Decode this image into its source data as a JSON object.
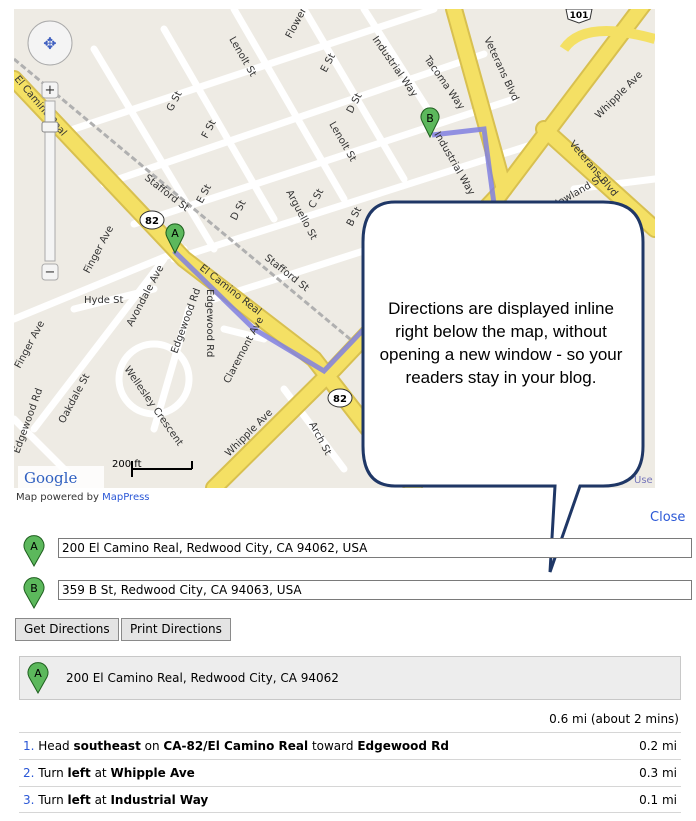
{
  "map": {
    "streets": [
      "Veterans Blvd",
      "Whipple Ave",
      "Veterans Blvd",
      "El Camino Real",
      "El Camino Real",
      "Stafford St",
      "Stafford St",
      "Industrial Way",
      "Industrial Way",
      "Tacoma Way",
      "Lenolt St",
      "Lenolt St",
      "E St",
      "D St",
      "F St",
      "G St",
      "E St",
      "D St",
      "C St",
      "B St",
      "Arguello St",
      "Flower St",
      "Finger Ave",
      "Finger Ave",
      "Hyde St",
      "Avondale Ave",
      "Edgewood Rd",
      "Edgewood Rd",
      "Edgewood Rd",
      "Claremont Ave",
      "Wellesley Crescent",
      "Oakdale St",
      "Whipple Ave",
      "Arch St",
      "Howland St"
    ],
    "highway_shields": [
      "101",
      "82",
      "82"
    ],
    "marker_a_label": "A",
    "marker_b_label": "B",
    "google_logo": "Google",
    "scale_label": "200 ft",
    "terms_label": "Use",
    "route_color": "#8080e0"
  },
  "powered_by": {
    "prefix": "Map powered by ",
    "link": "MapPress"
  },
  "callout": {
    "text": "Directions are displayed inline right below the map, without opening a new window - so your readers stay in your blog."
  },
  "directions_form": {
    "close_label": "Close",
    "from_label": "A",
    "from_value": "200 El Camino Real, Redwood City, CA 94062, USA",
    "to_label": "B",
    "to_value": "359 B St, Redwood City, CA 94063, USA",
    "get_directions_label": "Get Directions",
    "print_directions_label": "Print Directions"
  },
  "results": {
    "start_label": "A",
    "start_address": "200 El Camino Real, Redwood City, CA 94062",
    "summary": "0.6 mi (about 2 mins)",
    "steps": [
      {
        "num": "1.",
        "pre": "Head ",
        "b1": "southeast",
        "mid1": " on ",
        "b2": "CA-82/El Camino Real",
        "mid2": " toward ",
        "b3": "Edgewood Rd",
        "distance": "0.2 mi"
      },
      {
        "num": "2.",
        "pre": "Turn ",
        "b1": "left",
        "mid1": " at ",
        "b2": "Whipple Ave",
        "mid2": "",
        "b3": "",
        "distance": "0.3 mi"
      },
      {
        "num": "3.",
        "pre": "Turn ",
        "b1": "left",
        "mid1": " at ",
        "b2": "Industrial Way",
        "mid2": "",
        "b3": "",
        "distance": "0.1 mi"
      }
    ]
  },
  "colors": {
    "major_road": "#f4e064",
    "road_edge": "#d8c050",
    "link": "#2a57d6",
    "marker": "#5cb85c"
  }
}
